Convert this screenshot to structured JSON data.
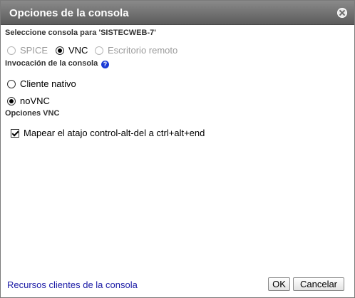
{
  "dialog": {
    "title": "Opciones de la consola"
  },
  "console_select": {
    "label": "Seleccione consola para 'SISTECWEB-7'",
    "options": [
      {
        "label": "SPICE",
        "checked": false,
        "disabled": true
      },
      {
        "label": "VNC",
        "checked": true,
        "disabled": false
      },
      {
        "label": "Escritorio remoto",
        "checked": false,
        "disabled": true
      }
    ]
  },
  "invocation": {
    "label": "Invocación de la consola",
    "help_glyph": "?",
    "options": [
      {
        "label": "Cliente nativo",
        "checked": false
      },
      {
        "label": "noVNC",
        "checked": true
      }
    ]
  },
  "vnc_options": {
    "label": "Opciones VNC",
    "ctrl_alt_del": {
      "label": "Mapear el atajo control-alt-del a ctrl+alt+end",
      "checked": true
    }
  },
  "footer": {
    "link": "Recursos clientes de la consola",
    "ok": "OK",
    "cancel": "Cancelar"
  }
}
